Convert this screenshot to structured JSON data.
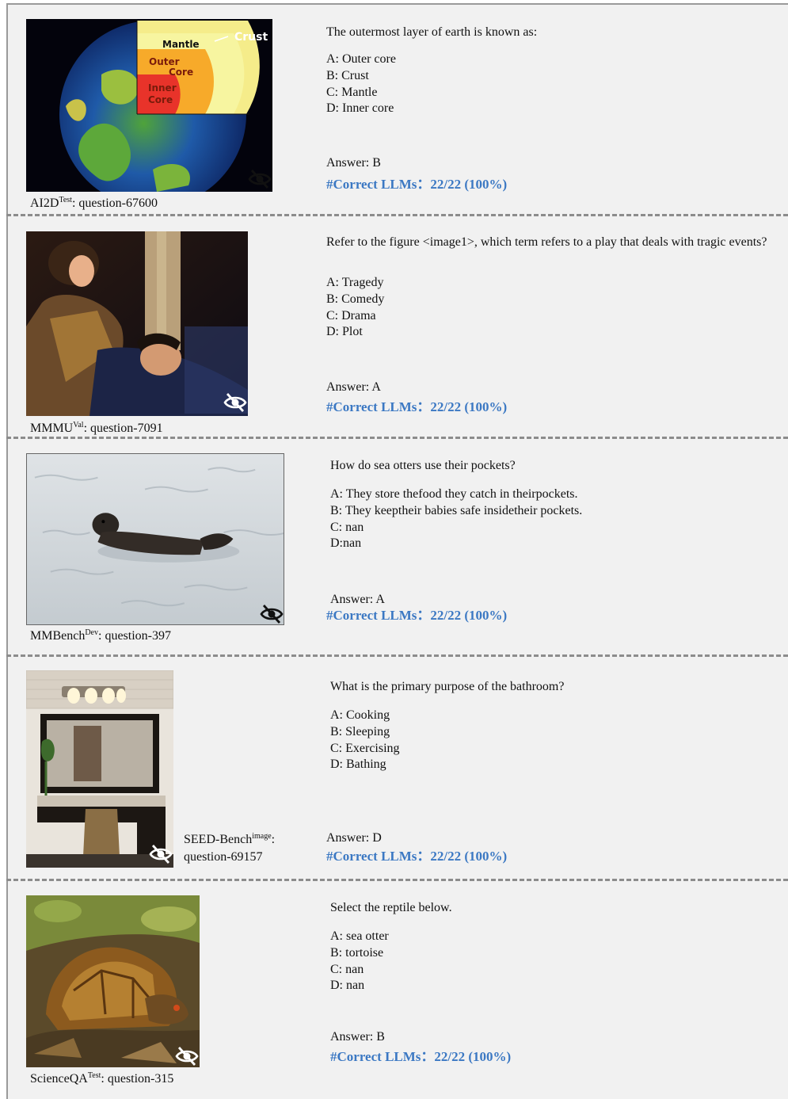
{
  "items": [
    {
      "source": "AI2D",
      "split": "Test",
      "qid": ": question-67600",
      "question": "The outermost layer of earth is known as:",
      "options": [
        "A: Outer core",
        "B: Crust",
        "C: Mantle",
        "D: Inner core"
      ],
      "answer": "Answer: B",
      "correct": "#Correct LLMs：22/22 (100%)",
      "image_labels": {
        "mantle": "Mantle",
        "crust": "Crust",
        "outer": "Outer",
        "core": "Core",
        "inner": "Inner",
        "core2": "Core"
      }
    },
    {
      "source": "MMMU",
      "split": "Val",
      "qid": ": question-7091",
      "question": "Refer to the figure <image1>, which term refers to a play that deals with tragic events?",
      "options": [
        "A: Tragedy",
        "B: Comedy",
        "C: Drama",
        "D: Plot"
      ],
      "answer": "Answer: A",
      "correct": "#Correct LLMs：22/22 (100%)"
    },
    {
      "source": "MMBench",
      "split": "Dev",
      "qid": ": question-397",
      "question": "How do sea otters use their pockets?",
      "options": [
        "A: They store thefood they catch in theirpockets.",
        "B: They keeptheir babies safe insidetheir pockets.",
        "C: nan",
        "D:nan"
      ],
      "answer": "Answer: A",
      "correct": "#Correct LLMs：22/22 (100%)"
    },
    {
      "source": "SEED-Bench",
      "split": "image",
      "qid_suffix": ":",
      "qid": "question-69157",
      "question": "What is the primary purpose of the bathroom?",
      "options": [
        "A: Cooking",
        "B: Sleeping",
        "C: Exercising",
        "D: Bathing"
      ],
      "answer": "Answer: D",
      "correct": "#Correct LLMs：22/22 (100%)"
    },
    {
      "source": "ScienceQA",
      "split": "Test",
      "qid": ": question-315",
      "question": "Select the reptile below.",
      "options": [
        "A: sea otter",
        "B: tortoise",
        "C: nan",
        "D: nan"
      ],
      "answer": "Answer: B",
      "correct": "#Correct LLMs：22/22 (100%)"
    }
  ],
  "icons": {
    "hidden": "eye-slash-icon"
  },
  "colors": {
    "correct_text": "#3b78c3",
    "panel_bg": "#f1f1f1",
    "separator": "#8c8c8c"
  }
}
